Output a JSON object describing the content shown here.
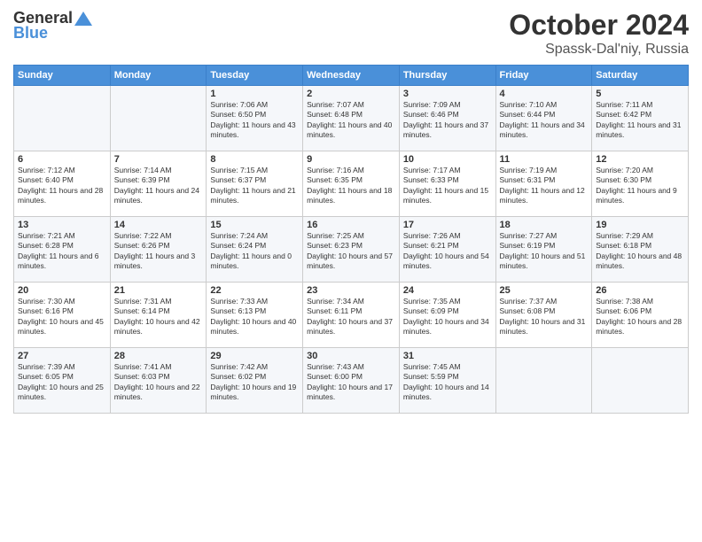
{
  "header": {
    "logo_general": "General",
    "logo_blue": "Blue",
    "month_title": "October 2024",
    "location": "Spassk-Dal'niy, Russia"
  },
  "days_of_week": [
    "Sunday",
    "Monday",
    "Tuesday",
    "Wednesday",
    "Thursday",
    "Friday",
    "Saturday"
  ],
  "weeks": [
    [
      {
        "day": "",
        "sunrise": "",
        "sunset": "",
        "daylight": ""
      },
      {
        "day": "",
        "sunrise": "",
        "sunset": "",
        "daylight": ""
      },
      {
        "day": "1",
        "sunrise": "Sunrise: 7:06 AM",
        "sunset": "Sunset: 6:50 PM",
        "daylight": "Daylight: 11 hours and 43 minutes."
      },
      {
        "day": "2",
        "sunrise": "Sunrise: 7:07 AM",
        "sunset": "Sunset: 6:48 PM",
        "daylight": "Daylight: 11 hours and 40 minutes."
      },
      {
        "day": "3",
        "sunrise": "Sunrise: 7:09 AM",
        "sunset": "Sunset: 6:46 PM",
        "daylight": "Daylight: 11 hours and 37 minutes."
      },
      {
        "day": "4",
        "sunrise": "Sunrise: 7:10 AM",
        "sunset": "Sunset: 6:44 PM",
        "daylight": "Daylight: 11 hours and 34 minutes."
      },
      {
        "day": "5",
        "sunrise": "Sunrise: 7:11 AM",
        "sunset": "Sunset: 6:42 PM",
        "daylight": "Daylight: 11 hours and 31 minutes."
      }
    ],
    [
      {
        "day": "6",
        "sunrise": "Sunrise: 7:12 AM",
        "sunset": "Sunset: 6:40 PM",
        "daylight": "Daylight: 11 hours and 28 minutes."
      },
      {
        "day": "7",
        "sunrise": "Sunrise: 7:14 AM",
        "sunset": "Sunset: 6:39 PM",
        "daylight": "Daylight: 11 hours and 24 minutes."
      },
      {
        "day": "8",
        "sunrise": "Sunrise: 7:15 AM",
        "sunset": "Sunset: 6:37 PM",
        "daylight": "Daylight: 11 hours and 21 minutes."
      },
      {
        "day": "9",
        "sunrise": "Sunrise: 7:16 AM",
        "sunset": "Sunset: 6:35 PM",
        "daylight": "Daylight: 11 hours and 18 minutes."
      },
      {
        "day": "10",
        "sunrise": "Sunrise: 7:17 AM",
        "sunset": "Sunset: 6:33 PM",
        "daylight": "Daylight: 11 hours and 15 minutes."
      },
      {
        "day": "11",
        "sunrise": "Sunrise: 7:19 AM",
        "sunset": "Sunset: 6:31 PM",
        "daylight": "Daylight: 11 hours and 12 minutes."
      },
      {
        "day": "12",
        "sunrise": "Sunrise: 7:20 AM",
        "sunset": "Sunset: 6:30 PM",
        "daylight": "Daylight: 11 hours and 9 minutes."
      }
    ],
    [
      {
        "day": "13",
        "sunrise": "Sunrise: 7:21 AM",
        "sunset": "Sunset: 6:28 PM",
        "daylight": "Daylight: 11 hours and 6 minutes."
      },
      {
        "day": "14",
        "sunrise": "Sunrise: 7:22 AM",
        "sunset": "Sunset: 6:26 PM",
        "daylight": "Daylight: 11 hours and 3 minutes."
      },
      {
        "day": "15",
        "sunrise": "Sunrise: 7:24 AM",
        "sunset": "Sunset: 6:24 PM",
        "daylight": "Daylight: 11 hours and 0 minutes."
      },
      {
        "day": "16",
        "sunrise": "Sunrise: 7:25 AM",
        "sunset": "Sunset: 6:23 PM",
        "daylight": "Daylight: 10 hours and 57 minutes."
      },
      {
        "day": "17",
        "sunrise": "Sunrise: 7:26 AM",
        "sunset": "Sunset: 6:21 PM",
        "daylight": "Daylight: 10 hours and 54 minutes."
      },
      {
        "day": "18",
        "sunrise": "Sunrise: 7:27 AM",
        "sunset": "Sunset: 6:19 PM",
        "daylight": "Daylight: 10 hours and 51 minutes."
      },
      {
        "day": "19",
        "sunrise": "Sunrise: 7:29 AM",
        "sunset": "Sunset: 6:18 PM",
        "daylight": "Daylight: 10 hours and 48 minutes."
      }
    ],
    [
      {
        "day": "20",
        "sunrise": "Sunrise: 7:30 AM",
        "sunset": "Sunset: 6:16 PM",
        "daylight": "Daylight: 10 hours and 45 minutes."
      },
      {
        "day": "21",
        "sunrise": "Sunrise: 7:31 AM",
        "sunset": "Sunset: 6:14 PM",
        "daylight": "Daylight: 10 hours and 42 minutes."
      },
      {
        "day": "22",
        "sunrise": "Sunrise: 7:33 AM",
        "sunset": "Sunset: 6:13 PM",
        "daylight": "Daylight: 10 hours and 40 minutes."
      },
      {
        "day": "23",
        "sunrise": "Sunrise: 7:34 AM",
        "sunset": "Sunset: 6:11 PM",
        "daylight": "Daylight: 10 hours and 37 minutes."
      },
      {
        "day": "24",
        "sunrise": "Sunrise: 7:35 AM",
        "sunset": "Sunset: 6:09 PM",
        "daylight": "Daylight: 10 hours and 34 minutes."
      },
      {
        "day": "25",
        "sunrise": "Sunrise: 7:37 AM",
        "sunset": "Sunset: 6:08 PM",
        "daylight": "Daylight: 10 hours and 31 minutes."
      },
      {
        "day": "26",
        "sunrise": "Sunrise: 7:38 AM",
        "sunset": "Sunset: 6:06 PM",
        "daylight": "Daylight: 10 hours and 28 minutes."
      }
    ],
    [
      {
        "day": "27",
        "sunrise": "Sunrise: 7:39 AM",
        "sunset": "Sunset: 6:05 PM",
        "daylight": "Daylight: 10 hours and 25 minutes."
      },
      {
        "day": "28",
        "sunrise": "Sunrise: 7:41 AM",
        "sunset": "Sunset: 6:03 PM",
        "daylight": "Daylight: 10 hours and 22 minutes."
      },
      {
        "day": "29",
        "sunrise": "Sunrise: 7:42 AM",
        "sunset": "Sunset: 6:02 PM",
        "daylight": "Daylight: 10 hours and 19 minutes."
      },
      {
        "day": "30",
        "sunrise": "Sunrise: 7:43 AM",
        "sunset": "Sunset: 6:00 PM",
        "daylight": "Daylight: 10 hours and 17 minutes."
      },
      {
        "day": "31",
        "sunrise": "Sunrise: 7:45 AM",
        "sunset": "Sunset: 5:59 PM",
        "daylight": "Daylight: 10 hours and 14 minutes."
      },
      {
        "day": "",
        "sunrise": "",
        "sunset": "",
        "daylight": ""
      },
      {
        "day": "",
        "sunrise": "",
        "sunset": "",
        "daylight": ""
      }
    ]
  ]
}
